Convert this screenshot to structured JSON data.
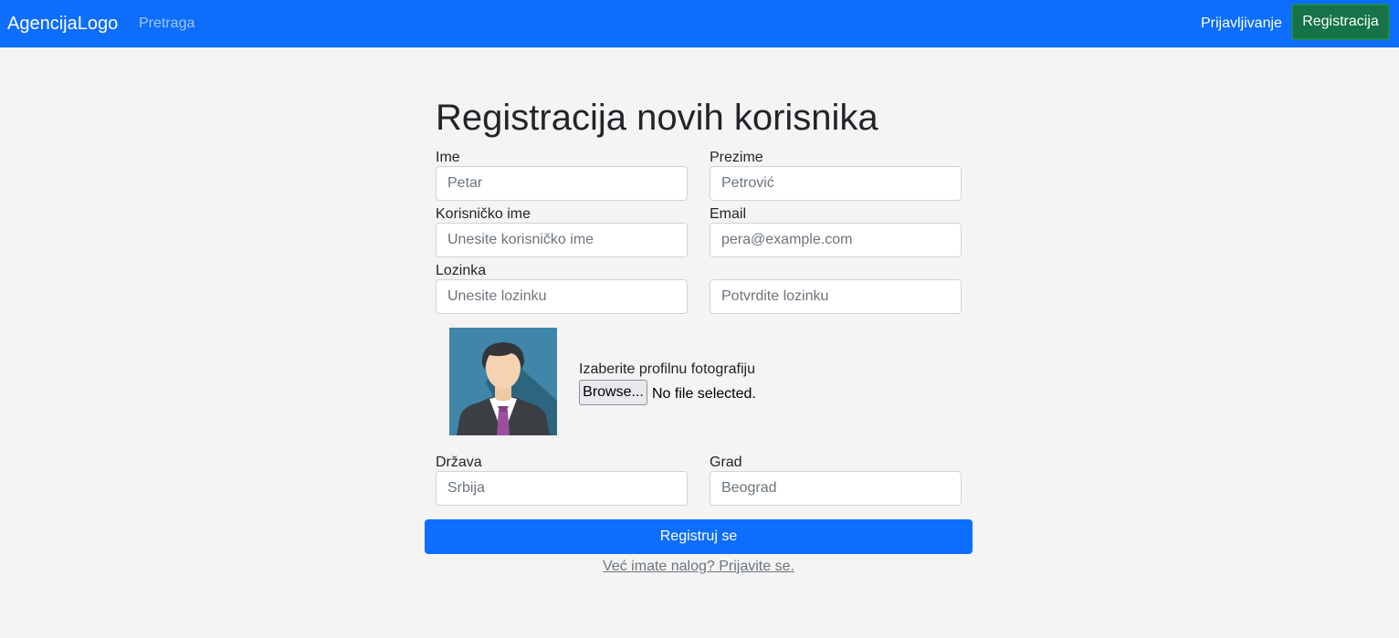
{
  "navbar": {
    "brand": "AgencijaLogo",
    "search_link": "Pretraga",
    "login_link": "Prijavljivanje",
    "register_button": "Registracija",
    "color": "#0d6efd"
  },
  "form": {
    "title": "Registracija novih korisnika",
    "first_name": {
      "label": "Ime",
      "placeholder": "Petar"
    },
    "last_name": {
      "label": "Prezime",
      "placeholder": "Petrović"
    },
    "username": {
      "label": "Korisničko ime",
      "placeholder": "Unesite korisničko ime"
    },
    "email": {
      "label": "Email",
      "placeholder": "pera@example.com"
    },
    "password": {
      "label": "Lozinka",
      "placeholder": "Unesite lozinku"
    },
    "password_confirm": {
      "placeholder": "Potvrdite lozinku"
    },
    "photo": {
      "label": "Izaberite profilnu fotografiju",
      "browse_label": "Browse...",
      "status": "No file selected.",
      "avatar_icon": "default-user-avatar-icon"
    },
    "country": {
      "label": "Država",
      "placeholder": "Srbija"
    },
    "city": {
      "label": "Grad",
      "placeholder": "Beograd"
    },
    "submit_label": "Registruj se",
    "login_prompt": "Već imate nalog? Prijavite se."
  }
}
